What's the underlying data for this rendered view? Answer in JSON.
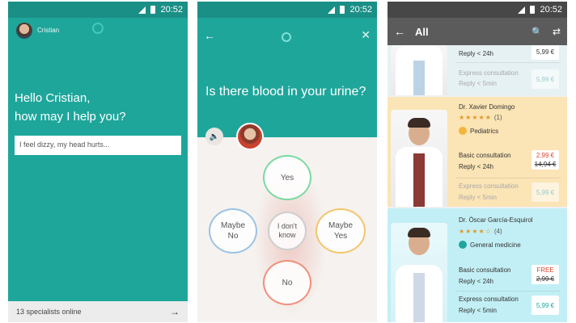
{
  "status": {
    "time": "20:52"
  },
  "screen1": {
    "user_name": "Cristian",
    "greeting": "Hello Cristian,\nhow may I help you?",
    "symptom_text": "I feel dizzy, my head hurts...",
    "specialists_text": "13 specialists online",
    "arrow": "→"
  },
  "screen2": {
    "back": "←",
    "close": "✕",
    "question": "Is there blood in your urine?",
    "speaker": "🔈",
    "answers": {
      "yes": "Yes",
      "maybe_no": "Maybe\nNo",
      "dont_know": "I don't\nknow",
      "maybe_yes": "Maybe\nYes",
      "no": "No"
    }
  },
  "screen3": {
    "title": "All",
    "back": "←",
    "search": "🔍",
    "filter": "⇄",
    "cards": [
      {
        "rows": [
          {
            "label": "Reply < 24h"
          },
          {
            "label": "Express consultation",
            "price": "5,99 €"
          },
          {
            "label": "Reply < 5min"
          }
        ],
        "top_price": "5,99 €"
      },
      {
        "name": "Dr. Xavier Domingo",
        "stars": "★★★★★",
        "rating_count": "(1)",
        "specialty": "Pediatrics",
        "specialty_color": "#f2b63c",
        "basic_label": "Basic consultation",
        "basic_reply": "Reply < 24h",
        "basic_price_now": "2,99 €",
        "basic_price_was": "14,94 €",
        "express_label": "Express consultation",
        "express_reply": "Reply < 5min",
        "express_price": "5,99 €"
      },
      {
        "name": "Dr. Óscar García-Esquirol",
        "stars": "★★★★☆",
        "rating_count": "(4)",
        "specialty": "General medicine",
        "specialty_color": "#1fa69b",
        "basic_label": "Basic consultation",
        "basic_reply": "Reply < 24h",
        "basic_price_now": "FREE",
        "basic_price_was": "2,99 €",
        "express_label": "Express consultation",
        "express_reply": "Reply < 5min",
        "express_price": "5,99 €"
      }
    ]
  }
}
